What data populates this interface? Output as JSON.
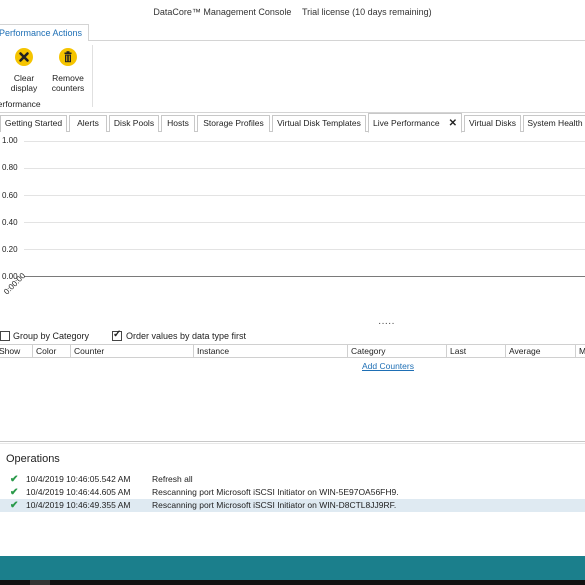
{
  "window": {
    "app_title": "DataCore™ Management Console",
    "license": "Trial license (10 days remaining)"
  },
  "ribbon": {
    "tab_label": "Performance Actions",
    "buttons": [
      {
        "label_line1": "Clear",
        "label_line2": "display",
        "icon": "clear-icon"
      },
      {
        "label_line1": "Remove",
        "label_line2": "counters",
        "icon": "remove-counters-icon"
      }
    ],
    "group_label": "Performance"
  },
  "doc_tabs": [
    "Getting Started",
    "Alerts",
    "Disk Pools",
    "Hosts",
    "Storage Profiles",
    "Virtual Disk Templates",
    "Live Performance",
    "Virtual Disks",
    "System Health"
  ],
  "active_tab_index": 6,
  "chart_data": {
    "type": "line",
    "y_ticks": [
      "1.00",
      "0.80",
      "0.60",
      "0.40",
      "0.20",
      "0.00"
    ],
    "x_ticks": [
      "0:00:00"
    ],
    "ylim": [
      0,
      1
    ],
    "series": []
  },
  "splitter_glyph": "·····",
  "options": {
    "group_by_category": {
      "label": "Group by Category",
      "checked": false
    },
    "order_values": {
      "label": "Order values by data type first",
      "checked": true
    }
  },
  "grid_columns": [
    "Show",
    "Color",
    "Counter",
    "Instance",
    "Category",
    "Last",
    "Average",
    "M"
  ],
  "add_counters_link": "Add Counters",
  "operations": {
    "title": "Operations",
    "rows": [
      {
        "time": "10/4/2019 10:46:05.542 AM",
        "desc": "Refresh all"
      },
      {
        "time": "10/4/2019 10:46:44.605 AM",
        "desc": "Rescanning port Microsoft iSCSI Initiator on WIN-5E97OA56FH9."
      },
      {
        "time": "10/4/2019 10:46:49.355 AM",
        "desc": "Rescanning port Microsoft iSCSI Initiator on WIN-D8CTL8JJ9RF."
      }
    ]
  },
  "colors": {
    "link": "#1e6fb5",
    "status_bar": "#1b7f8c",
    "success": "#2a9a4a",
    "icon_yellow": "#f5c400"
  }
}
